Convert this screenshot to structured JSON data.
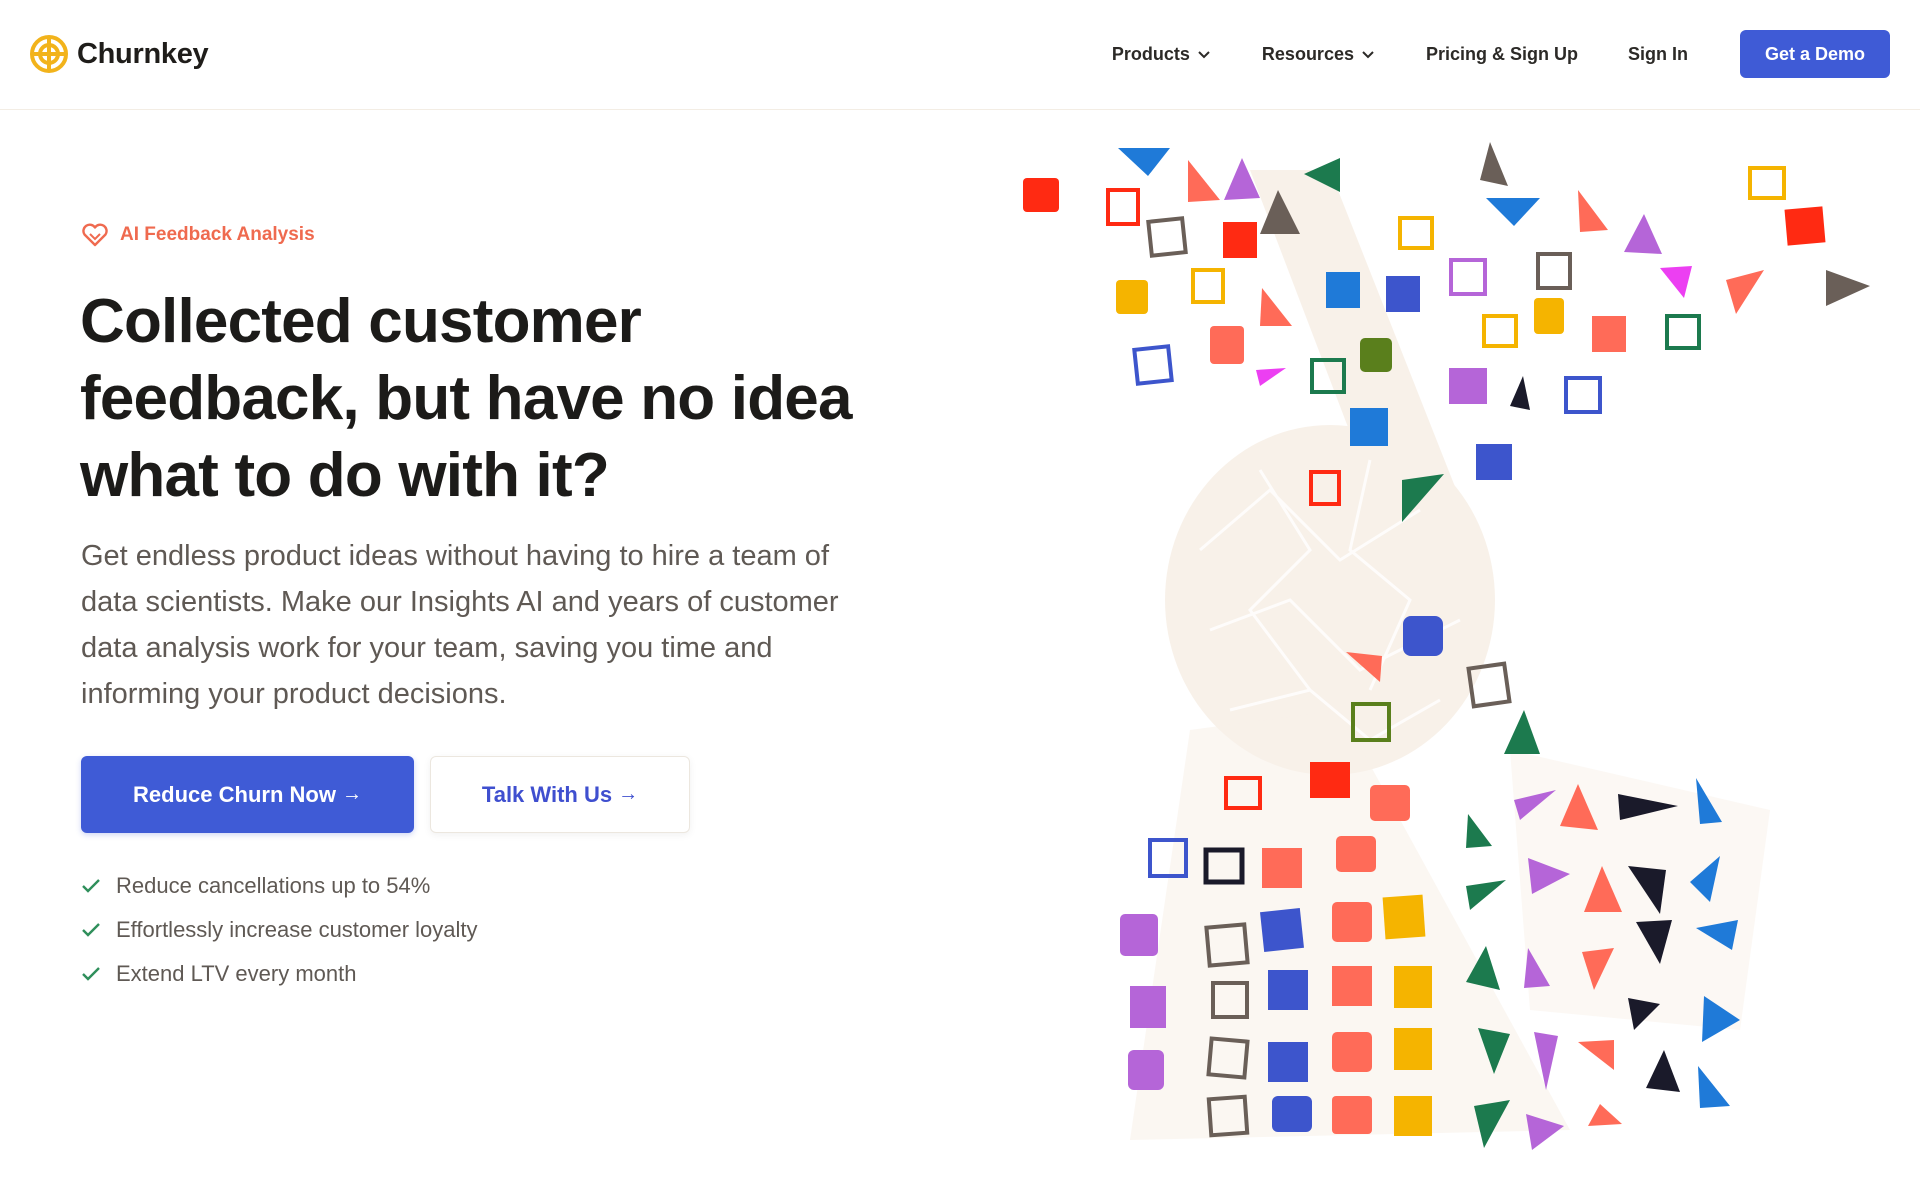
{
  "brand": {
    "name": "Churnkey",
    "logo_color": "#f2b31b",
    "logo_icon": "churnkey-logo-icon"
  },
  "nav": {
    "items": [
      {
        "label": "Products",
        "has_dropdown": true
      },
      {
        "label": "Resources",
        "has_dropdown": true
      },
      {
        "label": "Pricing & Sign Up",
        "has_dropdown": false
      },
      {
        "label": "Sign In",
        "has_dropdown": false
      }
    ],
    "cta_label": "Get a Demo"
  },
  "hero": {
    "eyebrow": "AI Feedback Analysis",
    "eyebrow_icon": "heart-icon",
    "headline": "Collected customer feedback, but have no idea what to do with it?",
    "subcopy": "Get endless product ideas without having to hire a team of data scientists. Make our Insights AI and years of customer data analysis work for your team, saving you time and informing your product decisions.",
    "primary_cta": "Reduce Churn Now",
    "secondary_cta": "Talk With Us",
    "arrow": "→",
    "checklist": [
      "Reduce cancellations up to 54%",
      "Effortlessly increase customer loyalty",
      "Extend LTV every month"
    ]
  },
  "colors": {
    "accent": "#3f5bd6",
    "eyebrow": "#ef6a4f",
    "check": "#2f8f5b",
    "shape_palette": [
      "#ff2a12",
      "#ff6b58",
      "#f5b400",
      "#1f7ad8",
      "#3d55cc",
      "#b565d8",
      "#1c7a4e",
      "#6a5f58",
      "#1a1a2a",
      "#ec3ff2",
      "#5a7f1c"
    ]
  }
}
